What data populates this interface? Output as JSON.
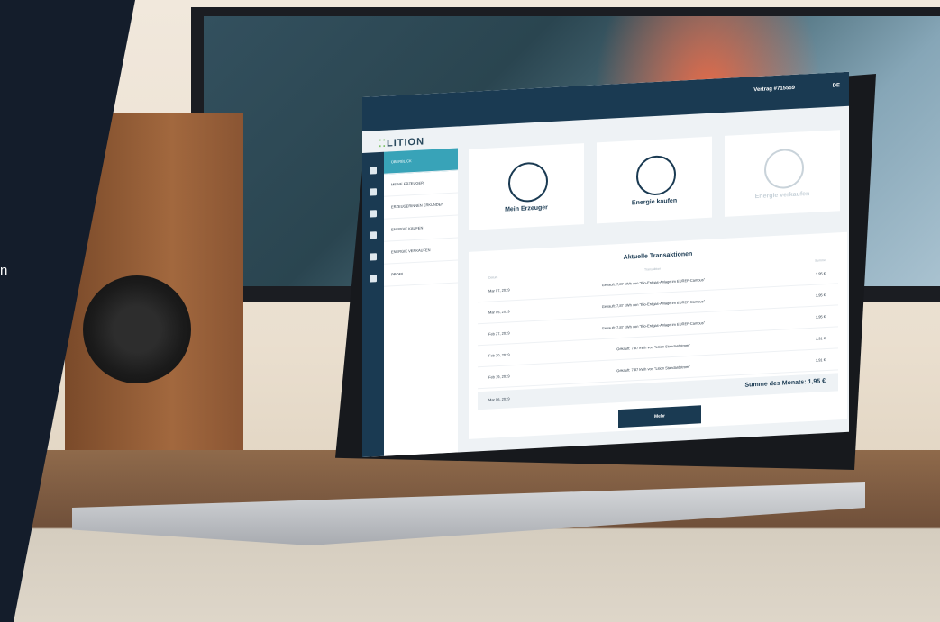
{
  "left_panel": {
    "text": "n",
    "color": "#141d2b"
  },
  "monitor": {
    "dots": [
      "dot-1",
      "dot-2",
      "dot-3"
    ]
  },
  "app": {
    "brand": "LITION",
    "contract": "Vertrag #715559",
    "language": "DE",
    "rail_icons": [
      "home-icon",
      "document-icon",
      "calculator-icon",
      "cart-icon",
      "chart-icon",
      "user-icon"
    ],
    "menu": [
      {
        "label": "ÜBERBLICK",
        "active": true
      },
      {
        "label": "MEINE ERZEUGER",
        "active": false
      },
      {
        "label": "ERZEUGERINNEN ERKUNDEN",
        "active": false
      },
      {
        "label": "ENERGIE KAUFEN",
        "active": false
      },
      {
        "label": "ENERGIE VERKAUFEN",
        "active": false
      },
      {
        "label": "PROFIL",
        "active": false
      }
    ],
    "tiles": [
      {
        "label": "Mein Erzeuger",
        "icon": "windmill-icon"
      },
      {
        "label": "Energie kaufen",
        "icon": "cart-leaf-icon"
      },
      {
        "label": "Energie verkaufen",
        "icon": "hand-leaf-icon"
      }
    ],
    "transactions": {
      "title": "Aktuelle Transaktionen",
      "col_date": "Datum",
      "col_tx": "Transaktion",
      "col_sum": "Summe",
      "rows": [
        {
          "date": "Mar 07, 2019",
          "text": "Gekauft: 7,87 kWh von \"Bio-Erdgas-Anlage im EUREF-Campus\"",
          "amount": "1,95 €"
        },
        {
          "date": "Mar 05, 2019",
          "text": "Gekauft: 7,87 kWh von \"Bio-Erdgas-Anlage im EUREF-Campus\"",
          "amount": "1,95 €"
        },
        {
          "date": "Feb 27, 2019",
          "text": "Gekauft: 7,87 kWh von \"Bio-Erdgas-Anlage im EUREF-Campus\"",
          "amount": "1,95 €"
        },
        {
          "date": "Feb 20, 2019",
          "text": "Gekauft: 7,87 kWh von \"Lition Standardstrom\"",
          "amount": "1,91 €"
        },
        {
          "date": "Feb 19, 2019",
          "text": "Gekauft: 7,87 kWh von \"Lition Standardstrom\"",
          "amount": "1,91 €"
        }
      ],
      "summary_date": "Mar 06, 2019",
      "summary": "Summe des Monats: 1,95 €",
      "more_button": "Mehr"
    }
  }
}
